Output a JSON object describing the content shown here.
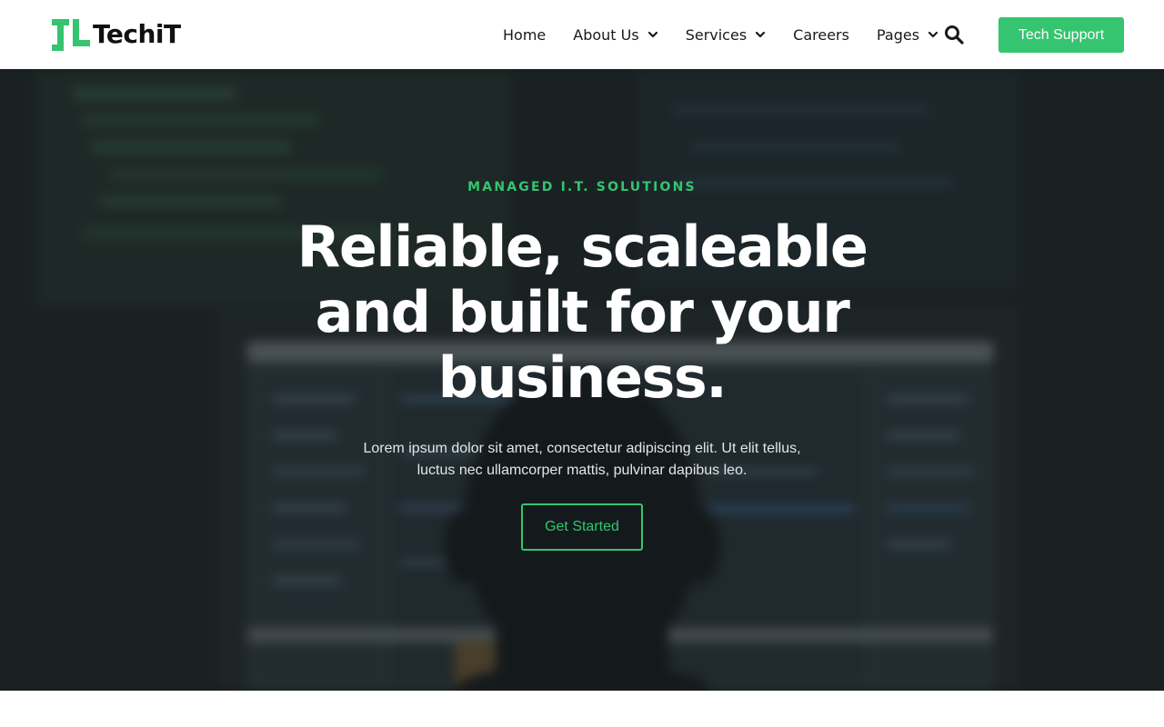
{
  "brand": {
    "name": "TechiT",
    "accent_color": "#35c46f",
    "logo_icon": "tech-logo-mark"
  },
  "nav": {
    "items": [
      {
        "label": "Home",
        "has_dropdown": false
      },
      {
        "label": "About Us",
        "has_dropdown": true
      },
      {
        "label": "Services",
        "has_dropdown": true
      },
      {
        "label": "Careers",
        "has_dropdown": false
      },
      {
        "label": "Pages",
        "has_dropdown": true
      }
    ],
    "search_icon": "search-icon",
    "cta_label": "Tech Support"
  },
  "hero": {
    "eyebrow": "MANAGED I.T. SOLUTIONS",
    "headline": "Reliable, scaleable and built for your business.",
    "subtext": "Lorem ipsum dolor sit amet, consectetur adipiscing elit. Ut elit tellus, luctus nec ullamcorper mattis, pulvinar dapibus leo.",
    "button_label": "Get Started",
    "background": "dark-photo-of-person-at-code-monitor"
  }
}
